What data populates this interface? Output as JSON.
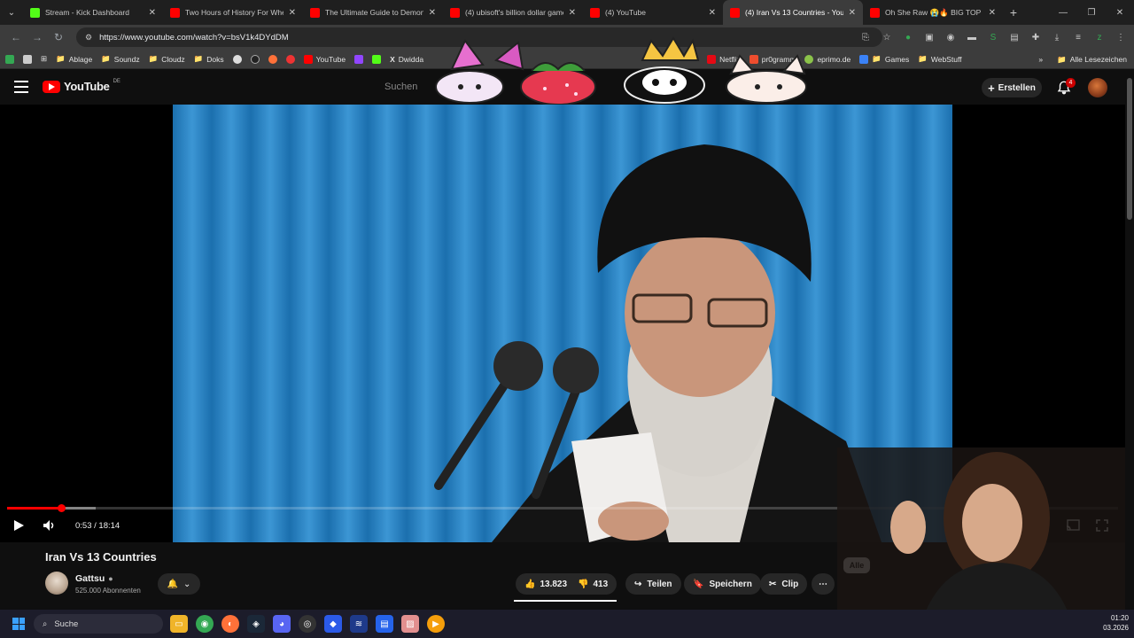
{
  "browser": {
    "tabs": [
      {
        "title": "Stream - Kick Dashboard",
        "color": "#53fc18"
      },
      {
        "title": "Two Hours of History For When",
        "color": "#ff0000"
      },
      {
        "title": "The Ultimate Guide to Demons",
        "color": "#ff0000"
      },
      {
        "title": "(4) ubisoft's billion dollar game",
        "color": "#ff0000"
      },
      {
        "title": "(4) YouTube",
        "color": "#ff0000"
      },
      {
        "title": "(4) Iran Vs 13 Countries - YouTu",
        "color": "#ff0000",
        "active": true
      },
      {
        "title": "Oh She Raw 😭🔥 BIG TOP",
        "color": "#ff0000"
      }
    ],
    "url": "https://www.youtube.com/watch?v=bsV1k4DYdDM",
    "bookmarks": [
      "Ablage",
      "Soundz",
      "Cloudz",
      "Doks",
      "YouTube",
      "Dwidda",
      "Netflix",
      "pr0gramm",
      "eprimo.de",
      "Games",
      "WebStuff"
    ],
    "bookmarks_all": "Alle Lesezeichen"
  },
  "youtube": {
    "logo_text": "YouTube",
    "country_code": "DE",
    "search_placeholder": "Suchen",
    "create_label": "Erstellen",
    "notification_count": "4",
    "video": {
      "title": "Iran Vs 13 Countries",
      "time_current": "0:53",
      "time_total": "18:14",
      "progress": 0.049,
      "buffered": 0.08
    },
    "channel": {
      "name": "Gattsu",
      "subscribers": "525.000 Abonnenten"
    },
    "actions": {
      "likes": "13.823",
      "dislikes": "413",
      "share": "Teilen",
      "save": "Speichern",
      "clip": "Clip"
    },
    "chip_all": "Alle",
    "colors": {
      "accent": "#ff0000",
      "background": "#0f0f0f"
    }
  },
  "taskbar": {
    "search_label": "Suche",
    "time": "01:20",
    "date": "03.2026"
  }
}
